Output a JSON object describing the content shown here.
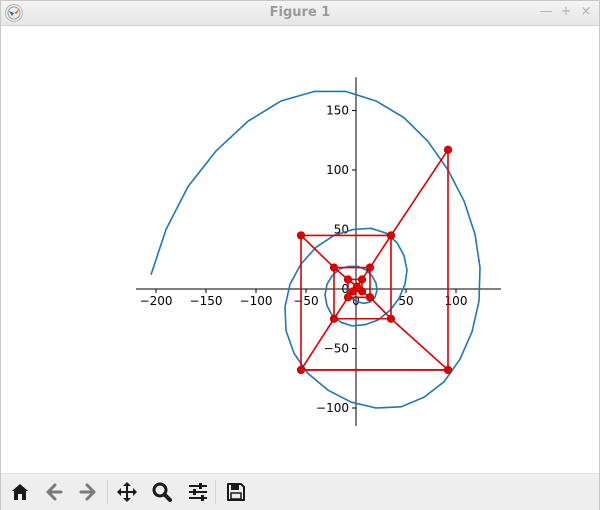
{
  "window": {
    "title": "Figure 1",
    "icon": "matplotlib-icon",
    "controls": [
      {
        "name": "minimize",
        "glyph": "—"
      },
      {
        "name": "maximize",
        "glyph": "+"
      },
      {
        "name": "close",
        "glyph": "×"
      }
    ]
  },
  "toolbar": {
    "buttons": [
      {
        "name": "home-icon",
        "tooltip": "Reset original view"
      },
      {
        "name": "back-arrow-icon",
        "tooltip": "Back to previous view"
      },
      {
        "name": "forward-arrow-icon",
        "tooltip": "Forward to next view"
      },
      {
        "name": "pan-move-icon",
        "tooltip": "Pan axes"
      },
      {
        "name": "zoom-magnifier-icon",
        "tooltip": "Zoom to rectangle"
      },
      {
        "name": "subplots-sliders-icon",
        "tooltip": "Configure subplots"
      },
      {
        "name": "save-floppy-icon",
        "tooltip": "Save the figure"
      }
    ]
  },
  "chart_data": {
    "type": "line",
    "title": "",
    "xlabel": "",
    "ylabel": "",
    "xlim": [
      -220,
      145
    ],
    "ylim": [
      -115,
      178
    ],
    "axes_through_origin": true,
    "grid": false,
    "x_ticks": [
      -200,
      -150,
      -100,
      -50,
      0,
      50,
      100
    ],
    "x_tick_labels": [
      "−200",
      "−150",
      "−100",
      "−50",
      "0",
      "50",
      "100"
    ],
    "y_ticks": [
      -100,
      -50,
      0,
      50,
      100,
      150
    ],
    "y_tick_labels": [
      "−100",
      "−50",
      "0",
      "50",
      "100",
      "150"
    ],
    "colors": {
      "spiral": "#1f77b4",
      "squares": "#dd0000",
      "axes": "#000000"
    },
    "spiral": {
      "description": "golden spiral through the square corners",
      "x": [
        -205,
        -190,
        -168,
        -140,
        -108,
        -75,
        -42,
        -10,
        20,
        48,
        72,
        92,
        108,
        119,
        124,
        123,
        116,
        104,
        88,
        68,
        45,
        20,
        -5,
        -28,
        -48,
        -62,
        -70,
        -71,
        -66,
        -55,
        -40,
        -22,
        -3,
        15,
        30,
        41,
        48,
        51,
        49,
        43,
        34,
        22,
        9,
        -4,
        -15,
        -24,
        -29,
        -31,
        -29,
        -24,
        -16,
        -7,
        2,
        10,
        16,
        20,
        21,
        19,
        14,
        8,
        2,
        -4,
        -8,
        -10
      ],
      "y": [
        12,
        50,
        86,
        116,
        141,
        158,
        166,
        166,
        158,
        144,
        124,
        100,
        74,
        46,
        18,
        -10,
        -36,
        -59,
        -78,
        -91,
        -99,
        -100,
        -95,
        -85,
        -71,
        -54,
        -35,
        -15,
        4,
        21,
        35,
        45,
        50,
        51,
        47,
        39,
        28,
        16,
        4,
        -8,
        -18,
        -26,
        -30,
        -31,
        -28,
        -22,
        -14,
        -5,
        4,
        11,
        17,
        19,
        19,
        16,
        11,
        5,
        -1,
        -7,
        -11,
        -12,
        -11,
        -8,
        -3,
        1
      ]
    },
    "square_points": [
      [
        92,
        117
      ],
      [
        92,
        -68
      ],
      [
        -55,
        -68
      ],
      [
        -55,
        45
      ],
      [
        35,
        45
      ],
      [
        35,
        -25
      ],
      [
        -22,
        -25
      ],
      [
        -22,
        18
      ],
      [
        14,
        18
      ],
      [
        14,
        -7
      ],
      [
        -8,
        -7
      ],
      [
        -8,
        8
      ],
      [
        6,
        8
      ],
      [
        6,
        -2
      ],
      [
        -3,
        -2
      ]
    ],
    "diagonal_polyline": [
      [
        92,
        117
      ],
      [
        35,
        45
      ],
      [
        14,
        18
      ],
      [
        6,
        8
      ],
      [
        1,
        2
      ],
      [
        -3,
        -2
      ],
      [
        -8,
        -7
      ],
      [
        -22,
        -25
      ],
      [
        -55,
        -68
      ],
      [
        92,
        -68
      ],
      [
        35,
        -25
      ],
      [
        14,
        -7
      ],
      [
        6,
        -2
      ],
      [
        1,
        2
      ],
      [
        -8,
        8
      ],
      [
        -22,
        18
      ],
      [
        -55,
        45
      ]
    ]
  }
}
